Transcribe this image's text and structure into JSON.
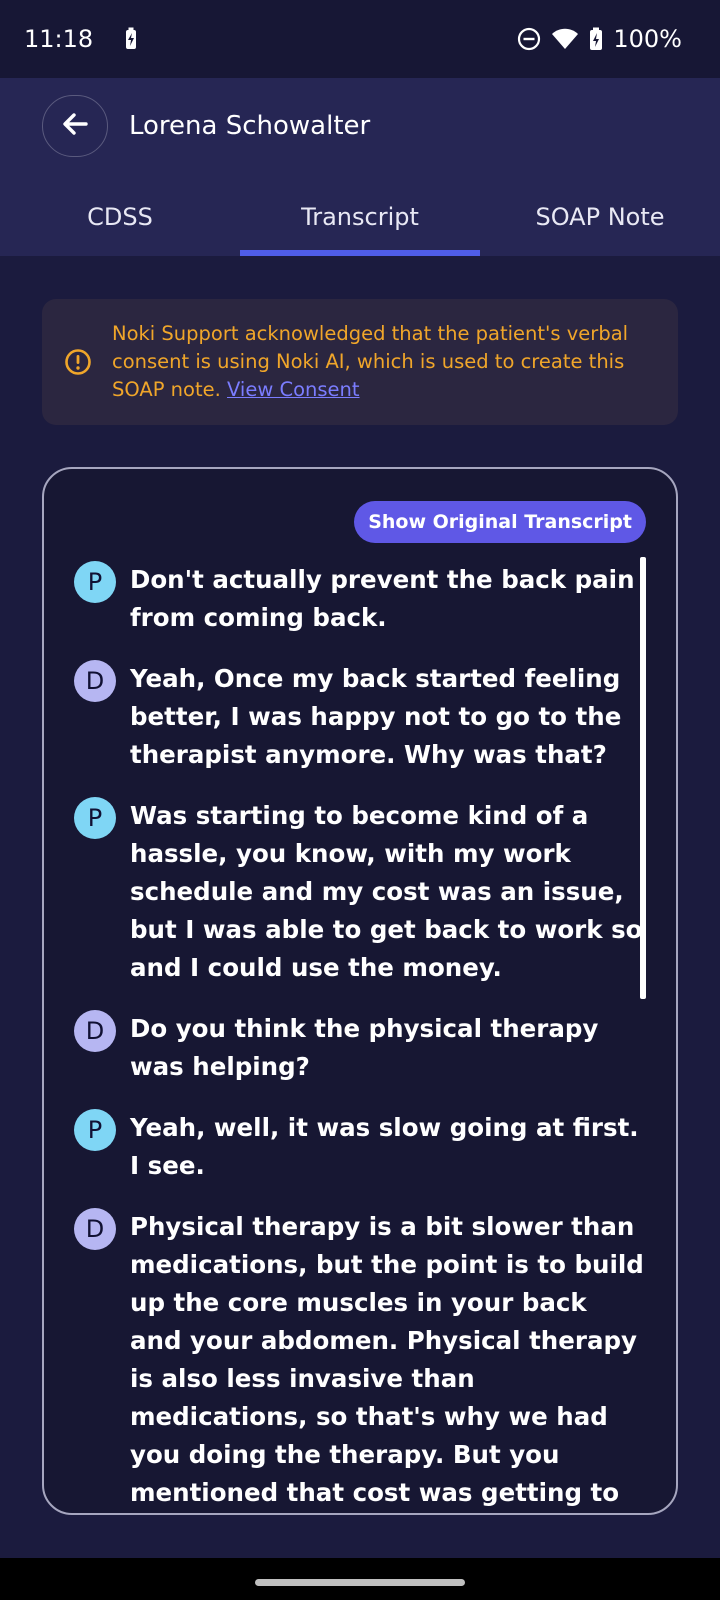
{
  "status_bar": {
    "time": "11:18",
    "battery_percent": "100%"
  },
  "header": {
    "patient_name": "Lorena Schowalter",
    "tabs": [
      {
        "label": "CDSS",
        "active": false
      },
      {
        "label": "Transcript",
        "active": true
      },
      {
        "label": "SOAP Note",
        "active": false
      }
    ]
  },
  "consent": {
    "text": "Noki Support acknowledged that the patient's verbal consent is using Noki AI, which is used to create this SOAP note.",
    "link_label": "View Consent"
  },
  "transcript": {
    "show_original_label": "Show Original Transcript",
    "messages": [
      {
        "speaker": "P",
        "text": "Don't actually prevent the back pain from coming back."
      },
      {
        "speaker": "D",
        "text": "Yeah, Once my back started feeling better, I was happy not to go to the therapist anymore. Why was that?"
      },
      {
        "speaker": "P",
        "text": "Was starting to become kind of a hassle, you know, with my work schedule and my cost was an issue, but I was able to get back to work so and I could use the money."
      },
      {
        "speaker": "D",
        "text": "Do you think the physical therapy was helping?"
      },
      {
        "speaker": "P",
        "text": "Yeah, well, it was slow going at first. I see."
      },
      {
        "speaker": "D",
        "text": "Physical therapy is a bit slower than medications, but the point is to build up the core muscles in your back and your abdomen. Physical therapy is also less invasive than medications, so that's why we had you doing the therapy. But you mentioned that cost was getting to be something of a concern"
      }
    ]
  },
  "colors": {
    "accent": "#4f5de8",
    "warning": "#f0a62a",
    "patient_avatar": "#7fd6f5",
    "doctor_avatar": "#b6b6f2"
  }
}
